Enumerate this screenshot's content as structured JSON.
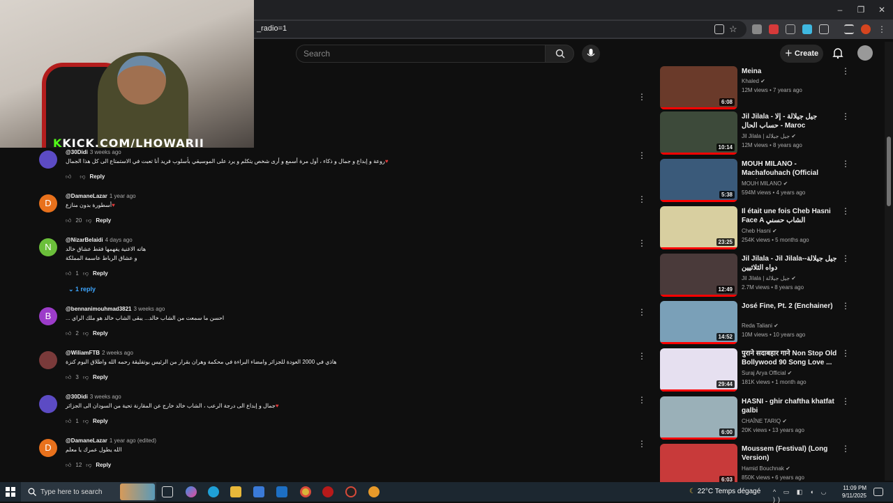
{
  "browser": {
    "url_fragment": "_radio=1",
    "window_controls": [
      "–",
      "❐",
      "✕"
    ]
  },
  "youtube": {
    "search_placeholder": "Search",
    "create_label": "Create"
  },
  "stream_overlay": {
    "kick_prefix": "K",
    "kick_text": "KICK.COM/LHOWARII"
  },
  "comments": [
    {
      "user": "@30Didi",
      "time": "3 weeks ago",
      "avatar_letter": "",
      "avatar_color": "#5c4bc4",
      "heart": true,
      "lines": [
        "روعة و إبداع و جمال و ذكاء ، أول مرة أسمع و أرى شخص يتكلم و يرد على الموسيقي بأسلوب فريد أنا تعبت في الاستمتاع الى كل هذا الجمال"
      ],
      "likes": "",
      "reply_label": "Reply"
    },
    {
      "user": "@DamaneLazar",
      "time": "1 year ago",
      "avatar_letter": "D",
      "avatar_color": "#e8711c",
      "heart": true,
      "lines": [
        "أسطورة بدون منازع"
      ],
      "likes": "20",
      "reply_label": "Reply"
    },
    {
      "user": "@NizarBelaidi",
      "time": "4 days ago",
      "avatar_letter": "N",
      "avatar_color": "#6bbf3a",
      "heart": false,
      "lines": [
        "هاته الاغنية يفهمها فقط عشاق خالد",
        "و عشاق الرباط عاسمة المملكة"
      ],
      "likes": "1",
      "reply_label": "Reply"
    },
    {
      "user": "@bennanimouhmad3821",
      "time": "3 weeks ago",
      "avatar_letter": "B",
      "avatar_color": "#9c3cc9",
      "heart": false,
      "lines": [
        "احسن ما سمعت من الشاب خالد... يبقى الشاب خالد هو ملك الراي ..."
      ],
      "likes": "2",
      "reply_label": "Reply"
    },
    {
      "user": "@WiliamFTB",
      "time": "2 weeks ago",
      "avatar_letter": "",
      "avatar_color": "#7a3a3a",
      "heart": false,
      "lines": [
        "هاذي في 2000 العودة للجزائر وامضاء البراءة في محكمة وهران بقرار من الرئيس بوتفليقة رحمه الله واطلاق البوم كنزة"
      ],
      "likes": "3",
      "reply_label": "Reply"
    },
    {
      "user": "@30Didi",
      "time": "3 weeks ago",
      "avatar_letter": "",
      "avatar_color": "#5c4bc4",
      "heart": true,
      "lines": [
        "جمال و إبداع الى درجة الرعب ، الشاب خالد خارج عن المقارنة تحية من السودان الى الجزائر"
      ],
      "likes": "1",
      "reply_label": "Reply"
    },
    {
      "user": "@DamaneLazar",
      "time": "1 year ago (edited)",
      "avatar_letter": "D",
      "avatar_color": "#e8711c",
      "heart": false,
      "lines": [
        "الله يطول عمرك يا معلم"
      ],
      "likes": "12",
      "reply_label": "Reply"
    }
  ],
  "replies_toggle": "1 reply",
  "sidebar": [
    {
      "title": "Meina",
      "channel": "Khaled",
      "meta": "12M views • 7 years ago",
      "duration": "6:08",
      "thumb": "#6a3a2a"
    },
    {
      "title": "Jil Jilala - جيل جيلالة - إلا حساب الحال - Maroc",
      "channel": "Jil Jilala | جيل جيلالة",
      "meta": "12M views • 8 years ago",
      "duration": "10:14",
      "thumb": "#3d4a3a"
    },
    {
      "title": "MOUH MILANO - Machafouhach (Official Music ...",
      "channel": "MOUH MILANO",
      "meta": "594M views • 4 years ago",
      "duration": "5:38",
      "thumb": "#3a5a7a"
    },
    {
      "title": "Il était une fois Cheb Hasni Face A الشاب حسني",
      "channel": "Cheb Hasni",
      "meta": "254K views • 5 months ago",
      "duration": "23:25",
      "thumb": "#d8cfa0"
    },
    {
      "title": "Jil Jilala - Jil Jilala-جيل جيلالة-دواه الثلاثيين",
      "channel": "Jil Jilala | جيل جيلالة",
      "meta": "2.7M views • 8 years ago",
      "duration": "12:49",
      "thumb": "#4a3a3a"
    },
    {
      "title": "José Fine, Pt. 2 (Enchainer)",
      "channel": "Reda Taliani",
      "meta": "10M views • 10 years ago",
      "duration": "14:52",
      "thumb": "#7aa0b8"
    },
    {
      "title": "पुराने सदाबहार गाने Non Stop Old Bollywood 90 Song Love ...",
      "channel": "Suraj Arya Official",
      "meta": "181K views • 1 month ago",
      "duration": "29:44",
      "thumb": "#e6e0f0"
    },
    {
      "title": "HASNI - ghir chaftha khatfat galbi",
      "channel": "CHAÎNE TARIQ",
      "meta": "20K views • 13 years ago",
      "duration": "6:00",
      "thumb": "#9ab0b8"
    },
    {
      "title": "Moussem (Festival) (Long Version)",
      "channel": "Hamid Bouchnak",
      "meta": "850K views • 6 years ago",
      "duration": "6:03",
      "thumb": "#c83a3a"
    }
  ],
  "taskbar": {
    "search_placeholder": "Type here to search",
    "weather": "22°C  Temps dégagé",
    "time": "11:09 PM",
    "date": "9/11/2025"
  }
}
